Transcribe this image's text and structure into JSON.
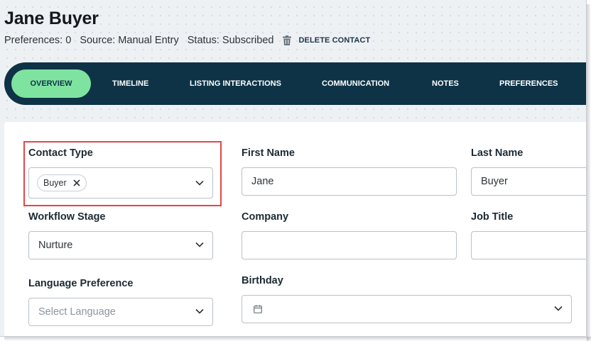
{
  "contact": {
    "name": "Jane Buyer",
    "preferences": "Preferences: 0",
    "source": "Source: Manual Entry",
    "status": "Status: Subscribed",
    "delete_label": "DELETE CONTACT"
  },
  "tabs": [
    {
      "label": "OVERVIEW",
      "active": true
    },
    {
      "label": "TIMELINE"
    },
    {
      "label": "LISTING INTERACTIONS"
    },
    {
      "label": "COMMUNICATION"
    },
    {
      "label": "NOTES"
    },
    {
      "label": "PREFERENCES"
    }
  ],
  "form": {
    "contact_type": {
      "label": "Contact Type",
      "chip": "Buyer"
    },
    "first_name": {
      "label": "First Name",
      "value": "Jane"
    },
    "last_name": {
      "label": "Last Name",
      "value": "Buyer"
    },
    "workflow_stage": {
      "label": "Workflow Stage",
      "value": "Nurture"
    },
    "company": {
      "label": "Company",
      "value": ""
    },
    "job_title": {
      "label": "Job Title",
      "value": ""
    },
    "language": {
      "label": "Language Preference",
      "placeholder": "Select Language"
    },
    "birthday": {
      "label": "Birthday",
      "value": ""
    }
  },
  "colors": {
    "nav_bg": "#0e3346",
    "active_tab": "#7fe3a0",
    "highlight": "#e2464b"
  },
  "icons": [
    "trash-icon",
    "close-icon",
    "chevron-down-icon",
    "calendar-icon"
  ]
}
